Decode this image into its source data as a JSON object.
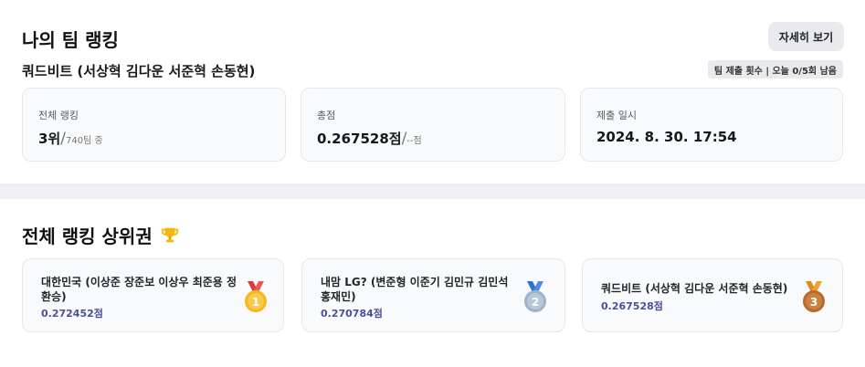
{
  "my_ranking": {
    "title": "나의 팀 랭킹",
    "detail_button": "자세히 보기",
    "team_name": "쿼드비트 (서상혁 김다운 서준혁 손동현)",
    "submission_badge": "팀 제출 횟수 | 오늘 0/5회 남음",
    "stats": {
      "overall_rank": {
        "label": "전체 랭킹",
        "value": "3위",
        "slash": "/",
        "sub": "740팀 중"
      },
      "total_score": {
        "label": "총점",
        "value": "0.267528점",
        "slash": "/",
        "sub": "--점"
      },
      "submitted_at": {
        "label": "제출 일시",
        "value": "2024. 8. 30. 17:54"
      }
    }
  },
  "top_ranking": {
    "title": "전체 랭킹 상위권",
    "trophy_icon": "trophy-icon",
    "entries": [
      {
        "rank": "1",
        "team": "대한민국 (이상준 장준보 이상우 최준용 정환승)",
        "score": "0.272452점",
        "medal_color": "#f5b81b"
      },
      {
        "rank": "2",
        "team": "내맘 LG? (변준형 이준기 김민규 김민석 홍재민)",
        "score": "0.270784점",
        "medal_color": "#9fb3c8"
      },
      {
        "rank": "3",
        "team": "쿼드비트 (서상혁 김다운 서준혁 손동현)",
        "score": "0.267528점",
        "medal_color": "#c9833f"
      }
    ]
  }
}
